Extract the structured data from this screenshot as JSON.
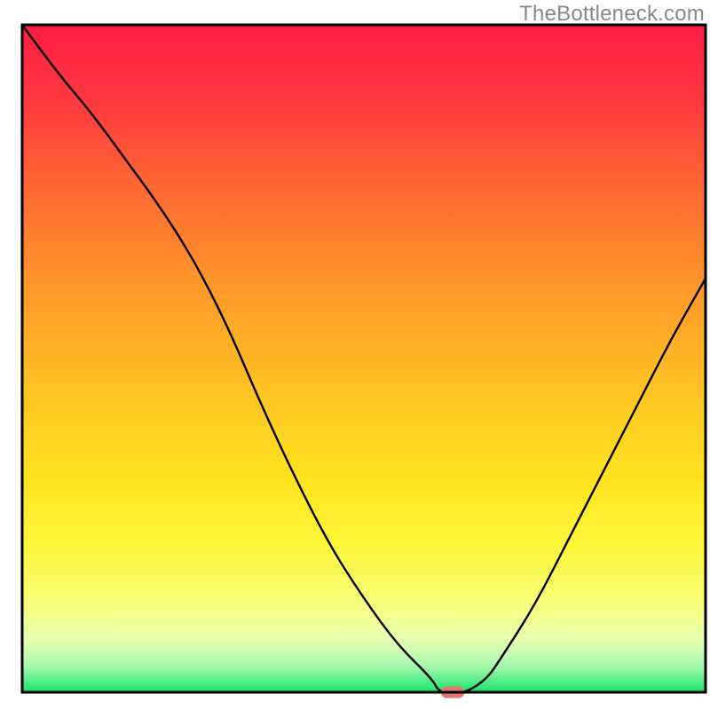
{
  "watermark": "TheBottleneck.com",
  "chart_data": {
    "type": "line",
    "title": "",
    "xlabel": "",
    "ylabel": "",
    "xlim": [
      0,
      100
    ],
    "ylim": [
      0,
      100
    ],
    "grid": false,
    "legend": false,
    "x": [
      0,
      5,
      10,
      15,
      20,
      25,
      30,
      35,
      40,
      45,
      50,
      55,
      60,
      61,
      63,
      65,
      68,
      70,
      75,
      80,
      85,
      90,
      95,
      100
    ],
    "y": [
      100,
      93,
      87,
      80,
      73,
      65,
      55,
      43,
      32,
      22,
      14,
      7,
      2,
      0,
      0,
      0,
      2,
      5,
      13,
      23,
      33,
      43,
      53,
      62
    ],
    "marker": {
      "x": 63,
      "y": 0,
      "color": "#e4766f",
      "shape": "pill"
    },
    "background_gradient": {
      "type": "vertical",
      "stops": [
        {
          "offset": 0.0,
          "color": "#ff1d44"
        },
        {
          "offset": 0.12,
          "color": "#ff3a3f"
        },
        {
          "offset": 0.25,
          "color": "#ff6a32"
        },
        {
          "offset": 0.4,
          "color": "#ff9a2a"
        },
        {
          "offset": 0.55,
          "color": "#ffc323"
        },
        {
          "offset": 0.68,
          "color": "#ffe31f"
        },
        {
          "offset": 0.78,
          "color": "#fdf73a"
        },
        {
          "offset": 0.86,
          "color": "#f8ff74"
        },
        {
          "offset": 0.92,
          "color": "#e8ffaf"
        },
        {
          "offset": 0.96,
          "color": "#a8f8b0"
        },
        {
          "offset": 1.0,
          "color": "#17e36a"
        }
      ]
    }
  }
}
